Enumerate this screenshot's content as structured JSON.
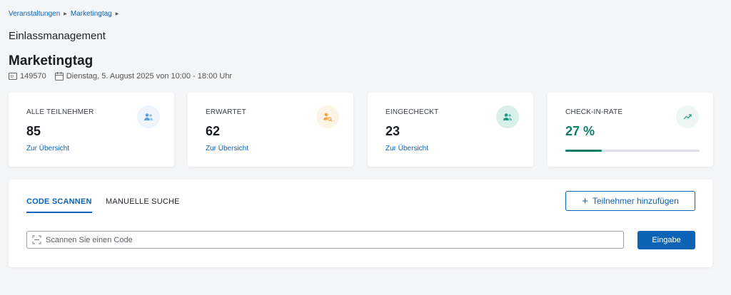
{
  "breadcrumb": {
    "items": [
      "Veranstaltungen",
      "Marketingtag"
    ]
  },
  "page": {
    "section_title": "Einlassmanagement"
  },
  "event": {
    "title": "Marketingtag",
    "id": "149570",
    "date": "Dienstag, 5. August 2025 von 10:00 - 18:00 Uhr"
  },
  "stats": [
    {
      "label": "ALLE TEILNEHMER",
      "value": "85",
      "link": "Zur Übersicht",
      "icon": "users-icon",
      "color": "#5aa0dc"
    },
    {
      "label": "ERWARTET",
      "value": "62",
      "link": "Zur Übersicht",
      "icon": "user-search-icon",
      "color": "#f0a640"
    },
    {
      "label": "EINGECHECKT",
      "value": "23",
      "link": "Zur Übersicht",
      "icon": "users-check-icon",
      "color": "#1e9a82"
    },
    {
      "label": "CHECK-IN-RATE",
      "value": "27 %",
      "icon": "trending-up-icon",
      "color": "#1e9a82",
      "progress": 0.27
    }
  ],
  "tabs": [
    "CODE SCANNEN",
    "MANUELLE SUCHE"
  ],
  "actions": {
    "add_participant": "Teilnehmer hinzufügen",
    "submit": "Eingabe"
  },
  "scan": {
    "placeholder": "Scannen Sie einen Code"
  }
}
